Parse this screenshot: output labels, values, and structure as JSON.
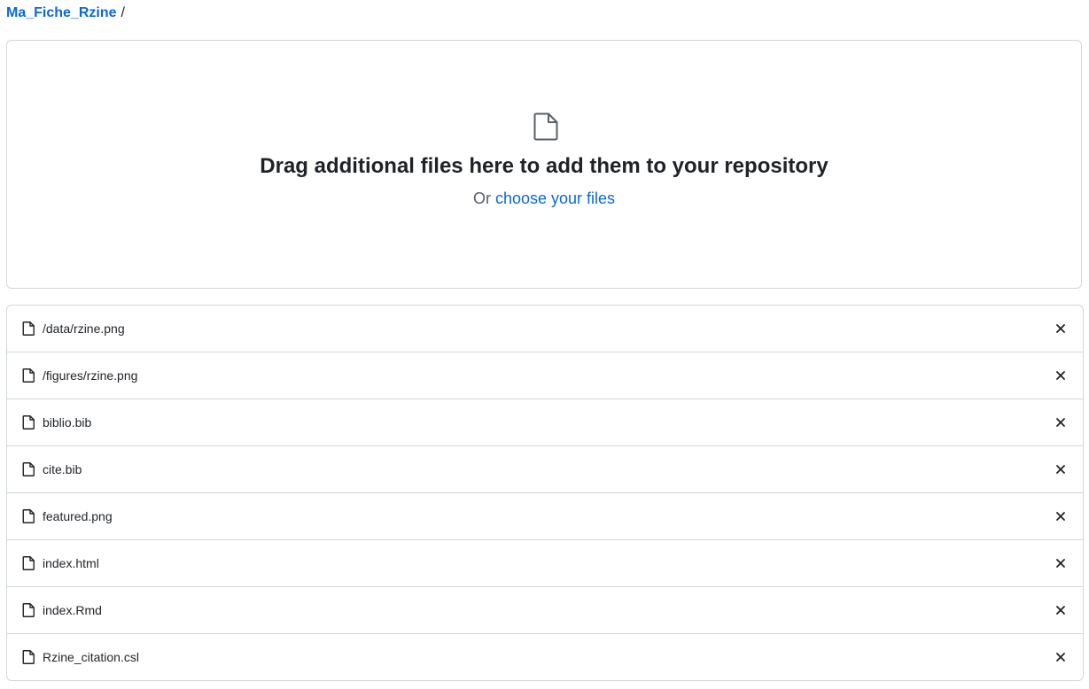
{
  "breadcrumb": {
    "repo": "Ma_Fiche_Rzine",
    "separator": "/"
  },
  "dropzone": {
    "title": "Drag additional files here to add them to your repository",
    "prefix": "Or",
    "link": "choose your files",
    "icon": "file-icon"
  },
  "files": [
    {
      "name": "/data/rzine.png"
    },
    {
      "name": "/figures/rzine.png"
    },
    {
      "name": "biblio.bib"
    },
    {
      "name": "cite.bib"
    },
    {
      "name": "featured.png"
    },
    {
      "name": "index.html"
    },
    {
      "name": "index.Rmd"
    },
    {
      "name": "Rzine_citation.csl"
    }
  ],
  "colors": {
    "link": "#0969da",
    "border": "#d0d7de",
    "text": "#1f2328",
    "muted": "#57606a"
  }
}
